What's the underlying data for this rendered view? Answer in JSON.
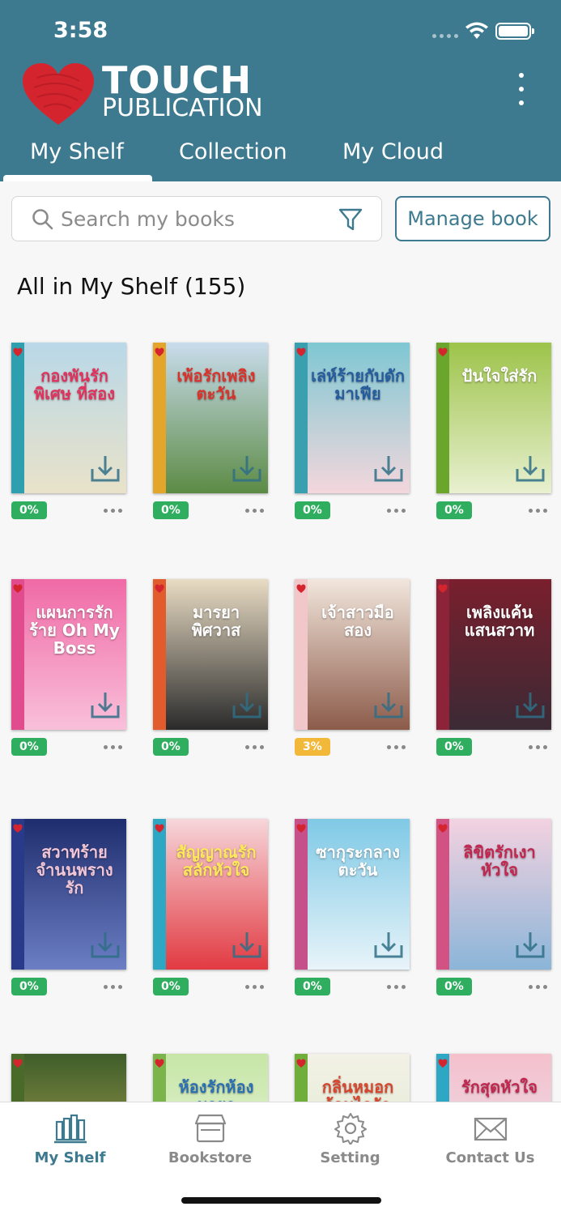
{
  "status": {
    "time": "3:58"
  },
  "brand": {
    "line1": "TOUCH",
    "line2": "PUBLICATION",
    "heart_color": "#d4252f"
  },
  "tabs": [
    {
      "label": "My Shelf",
      "active": true
    },
    {
      "label": "Collection",
      "active": false
    },
    {
      "label": "My Cloud",
      "active": false
    }
  ],
  "search": {
    "placeholder": "Search my books"
  },
  "manage_label": "Manage book",
  "shelf_title": "All in My Shelf (155)",
  "books": [
    {
      "title": "กองพันรักพิเศษ ที่สอง",
      "progress": "0%",
      "colors": {
        "bg1": "#b9d8e8",
        "bg2": "#e9e2c9",
        "title": "#e0325c",
        "spine": "#2e9fae"
      }
    },
    {
      "title": "เพ้อรักเพลิงตะวัน",
      "progress": "0%",
      "colors": {
        "bg1": "#c9dcec",
        "bg2": "#5c8b45",
        "title": "#d8342e",
        "spine": "#e3a52a"
      }
    },
    {
      "title": "เล่ห์ร้ายกับดักมาเฟีย",
      "progress": "0%",
      "colors": {
        "bg1": "#7ec7d3",
        "bg2": "#f3d7dc",
        "title": "#245c9e",
        "spine": "#3aa0b0"
      }
    },
    {
      "title": "ปันใจใส่รัก",
      "progress": "0%",
      "colors": {
        "bg1": "#9dc34a",
        "bg2": "#e8f0d0",
        "title": "#ffffff",
        "spine": "#6aa52c"
      }
    },
    {
      "title": "แผนการรักร้าย Oh My Boss",
      "progress": "0%",
      "colors": {
        "bg1": "#f06aa6",
        "bg2": "#f9c0da",
        "title": "#ffffff",
        "spine": "#e14c8f"
      }
    },
    {
      "title": "มารยาพิศวาส",
      "progress": "0%",
      "colors": {
        "bg1": "#e9dcc4",
        "bg2": "#2a2a2a",
        "title": "#ffffff",
        "spine": "#e25b2d"
      }
    },
    {
      "title": "เจ้าสาวมือสอง",
      "progress": "3%",
      "colors": {
        "bg1": "#f2e6dc",
        "bg2": "#8c5b4a",
        "title": "#ffffff",
        "spine": "#f1c7c9"
      }
    },
    {
      "title": "เพลิงแค้นแสนสวาท",
      "progress": "0%",
      "colors": {
        "bg1": "#7a1f2d",
        "bg2": "#3b2a35",
        "title": "#ffffff",
        "spine": "#8c2338"
      }
    },
    {
      "title": "สวาทร้ายจำนนพรางรัก",
      "progress": "0%",
      "colors": {
        "bg1": "#1e2d6d",
        "bg2": "#6c7ec4",
        "title": "#f2c6d6",
        "spine": "#2a3a8a"
      }
    },
    {
      "title": "สัญญาณรักสลักหัวใจ",
      "progress": "0%",
      "colors": {
        "bg1": "#f6d6da",
        "bg2": "#e23a42",
        "title": "#ffe95a",
        "spine": "#2ea7c5"
      }
    },
    {
      "title": "ซากุระกลางตะวัน",
      "progress": "0%",
      "colors": {
        "bg1": "#7fc9e6",
        "bg2": "#e8f4f9",
        "title": "#ffffff",
        "spine": "#c6508a"
      }
    },
    {
      "title": "ลิขิตรักเงาหัวใจ",
      "progress": "0%",
      "colors": {
        "bg1": "#f3d2e0",
        "bg2": "#8bb5d8",
        "title": "#c2264f",
        "spine": "#d25283"
      }
    },
    {
      "title": "",
      "progress": "",
      "colors": {
        "bg1": "#3e5d2a",
        "bg2": "#c8b45a",
        "title": "#ffffff",
        "spine": "#4a6a2a"
      }
    },
    {
      "title": "ห้องรักห้องมายา",
      "progress": "",
      "colors": {
        "bg1": "#c6e6a6",
        "bg2": "#f2f6e8",
        "title": "#2a6fb2",
        "spine": "#7bb44a"
      }
    },
    {
      "title": "กลิ่นหมอกร้อนไอรัก",
      "progress": "",
      "colors": {
        "bg1": "#f3f1e6",
        "bg2": "#d8e8c8",
        "title": "#d6462e",
        "spine": "#6fae3a"
      }
    },
    {
      "title": "รักสุดหัวใจ",
      "progress": "",
      "colors": {
        "bg1": "#f4c0cc",
        "bg2": "#e6e8f2",
        "title": "#c2264f",
        "spine": "#2ea7c5"
      }
    }
  ],
  "bottom_nav": [
    {
      "label": "My Shelf",
      "icon": "shelf-icon",
      "active": true
    },
    {
      "label": "Bookstore",
      "icon": "store-icon",
      "active": false
    },
    {
      "label": "Setting",
      "icon": "gear-icon",
      "active": false
    },
    {
      "label": "Contact Us",
      "icon": "mail-icon",
      "active": false
    }
  ],
  "theme": {
    "primary": "#3d7a8f",
    "progress_done": "#2fae5f",
    "progress_partial": "#f2b83a"
  }
}
